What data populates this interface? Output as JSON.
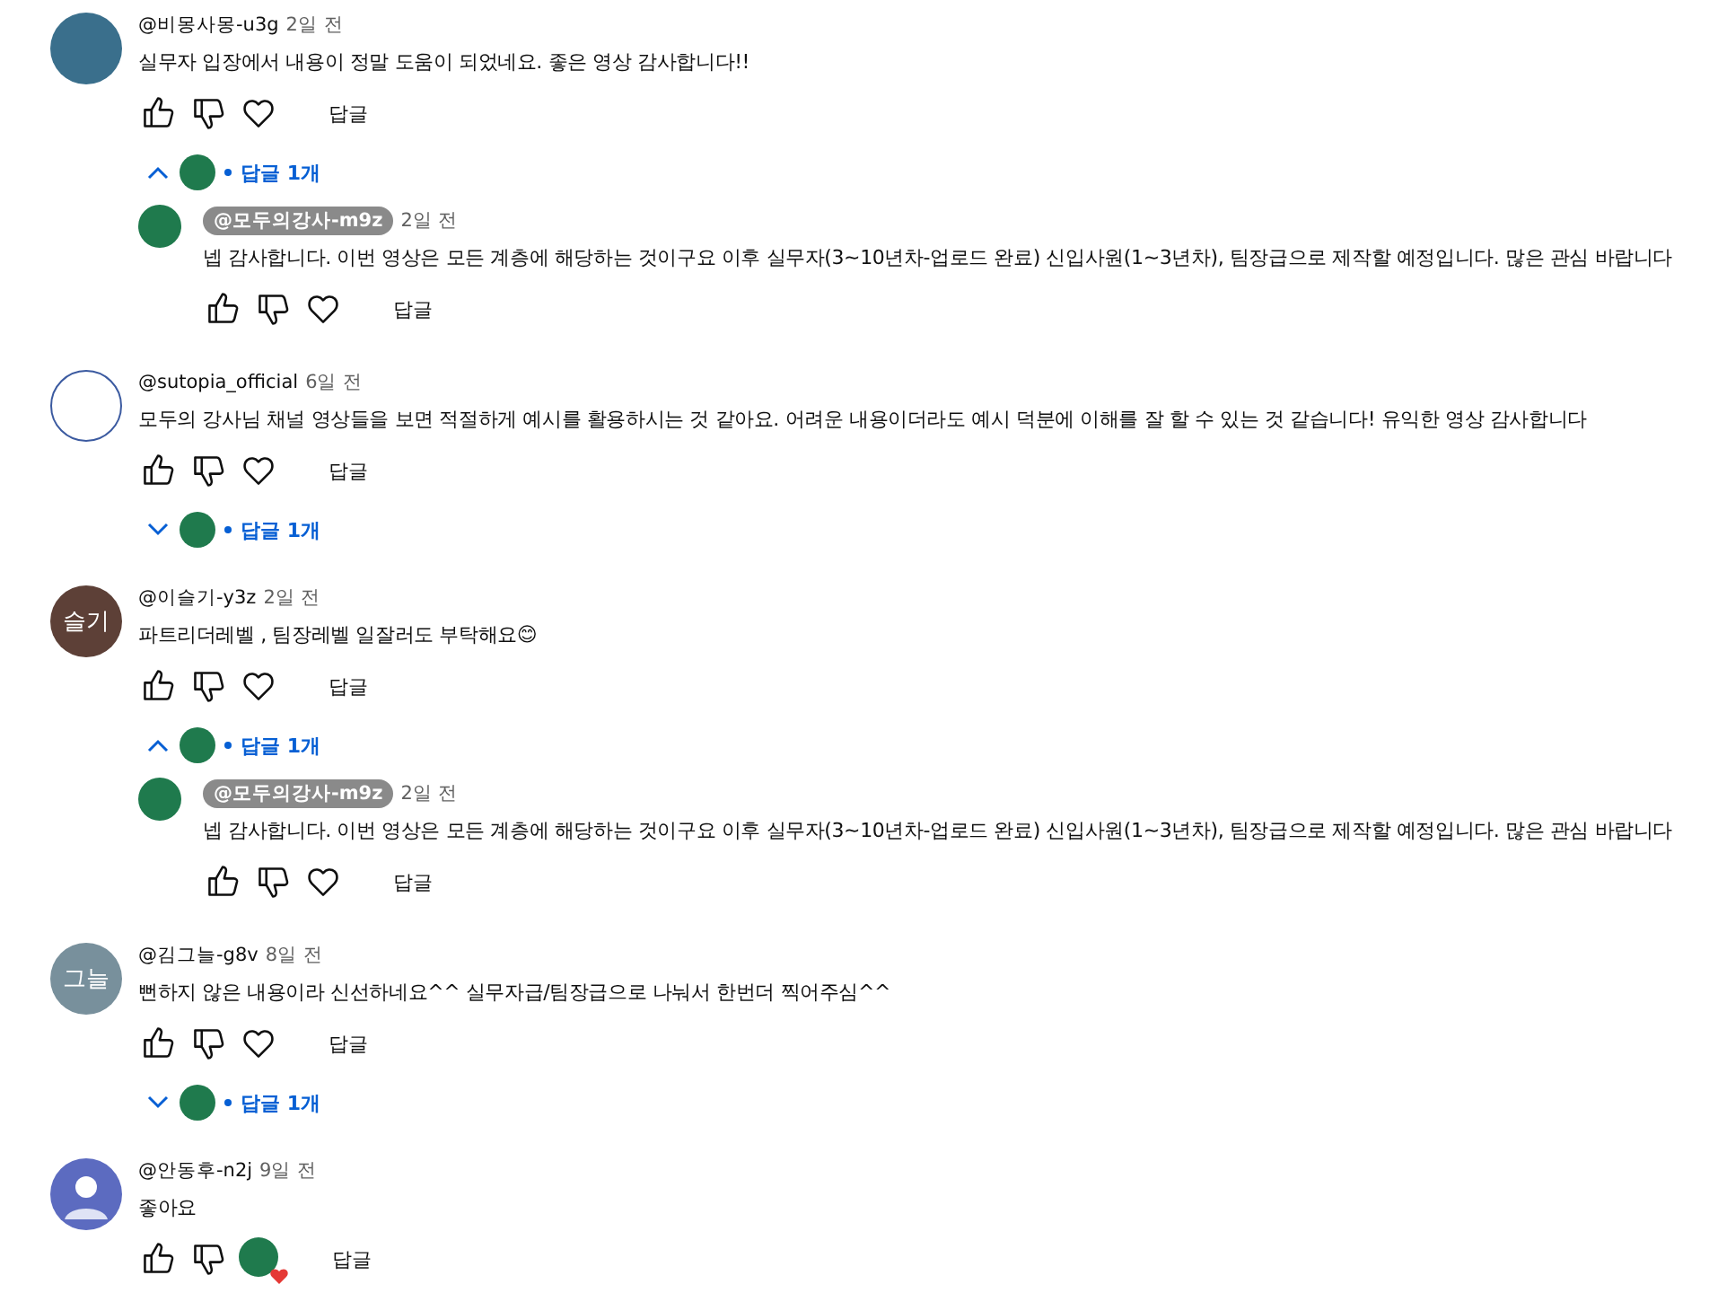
{
  "comments": [
    {
      "author": "@비몽사몽-u3g",
      "time": "2일 전",
      "text": "실무자 입장에서 내용이 정말 도움이 되었네요. 좋은 영상 감사합니다!!",
      "avatar": {
        "kind": "image",
        "color": "#3a6f8c"
      },
      "creator_heart": false,
      "reply_button": "답글",
      "replies_toggle": {
        "label": "답글 1개",
        "expanded": true
      },
      "replies": [
        {
          "author": "@모두의강사-m9z",
          "author_highlighted": true,
          "time": "2일 전",
          "text": "넵 감사합니다. 이번 영상은 모든 계층에 해당하는 것이구요 이후 실무자(3~10년차-업로드 완료) 신입사원(1~3년차), 팀장급으로 제작할 예정입니다. 많은 관심 바랍니다",
          "reply_button": "답글"
        }
      ]
    },
    {
      "author": "@sutopia_official",
      "time": "6일 전",
      "text": "모두의 강사님 채널 영상들을 보면 적절하게 예시를 활용하시는 것 같아요. 어려운 내용이더라도 예시 덕분에 이해를 잘 할 수 있는 것 같습니다! 유익한 영상 감사합니다",
      "avatar": {
        "kind": "logo",
        "color": "#ffffff"
      },
      "creator_heart": false,
      "reply_button": "답글",
      "replies_toggle": {
        "label": "답글 1개",
        "expanded": false
      }
    },
    {
      "author": "@이슬기-y3z",
      "time": "2일 전",
      "text": "파트리더레벨 , 팀장레벨 일잘러도 부탁해요😊",
      "avatar": {
        "kind": "initials",
        "text": "슬기",
        "color": "#5d4037"
      },
      "creator_heart": false,
      "reply_button": "답글",
      "replies_toggle": {
        "label": "답글 1개",
        "expanded": true
      },
      "replies": [
        {
          "author": "@모두의강사-m9z",
          "author_highlighted": true,
          "time": "2일 전",
          "text": "넵 감사합니다. 이번 영상은 모든 계층에 해당하는 것이구요 이후 실무자(3~10년차-업로드 완료) 신입사원(1~3년차), 팀장급으로 제작할 예정입니다. 많은 관심 바랍니다",
          "reply_button": "답글"
        }
      ]
    },
    {
      "author": "@김그늘-g8v",
      "time": "8일 전",
      "text": "뻔하지 않은 내용이라 신선하네요^^ 실무자급/팀장급으로 나눠서 한번더 찍어주심^^",
      "avatar": {
        "kind": "initials",
        "text": "그늘",
        "color": "#78909c"
      },
      "creator_heart": false,
      "reply_button": "답글",
      "replies_toggle": {
        "label": "답글 1개",
        "expanded": false
      }
    },
    {
      "author": "@안동후-n2j",
      "time": "9일 전",
      "text": "좋아요",
      "avatar": {
        "kind": "default",
        "color": "#5c6bc0"
      },
      "creator_heart": true,
      "reply_button": "답글"
    }
  ]
}
